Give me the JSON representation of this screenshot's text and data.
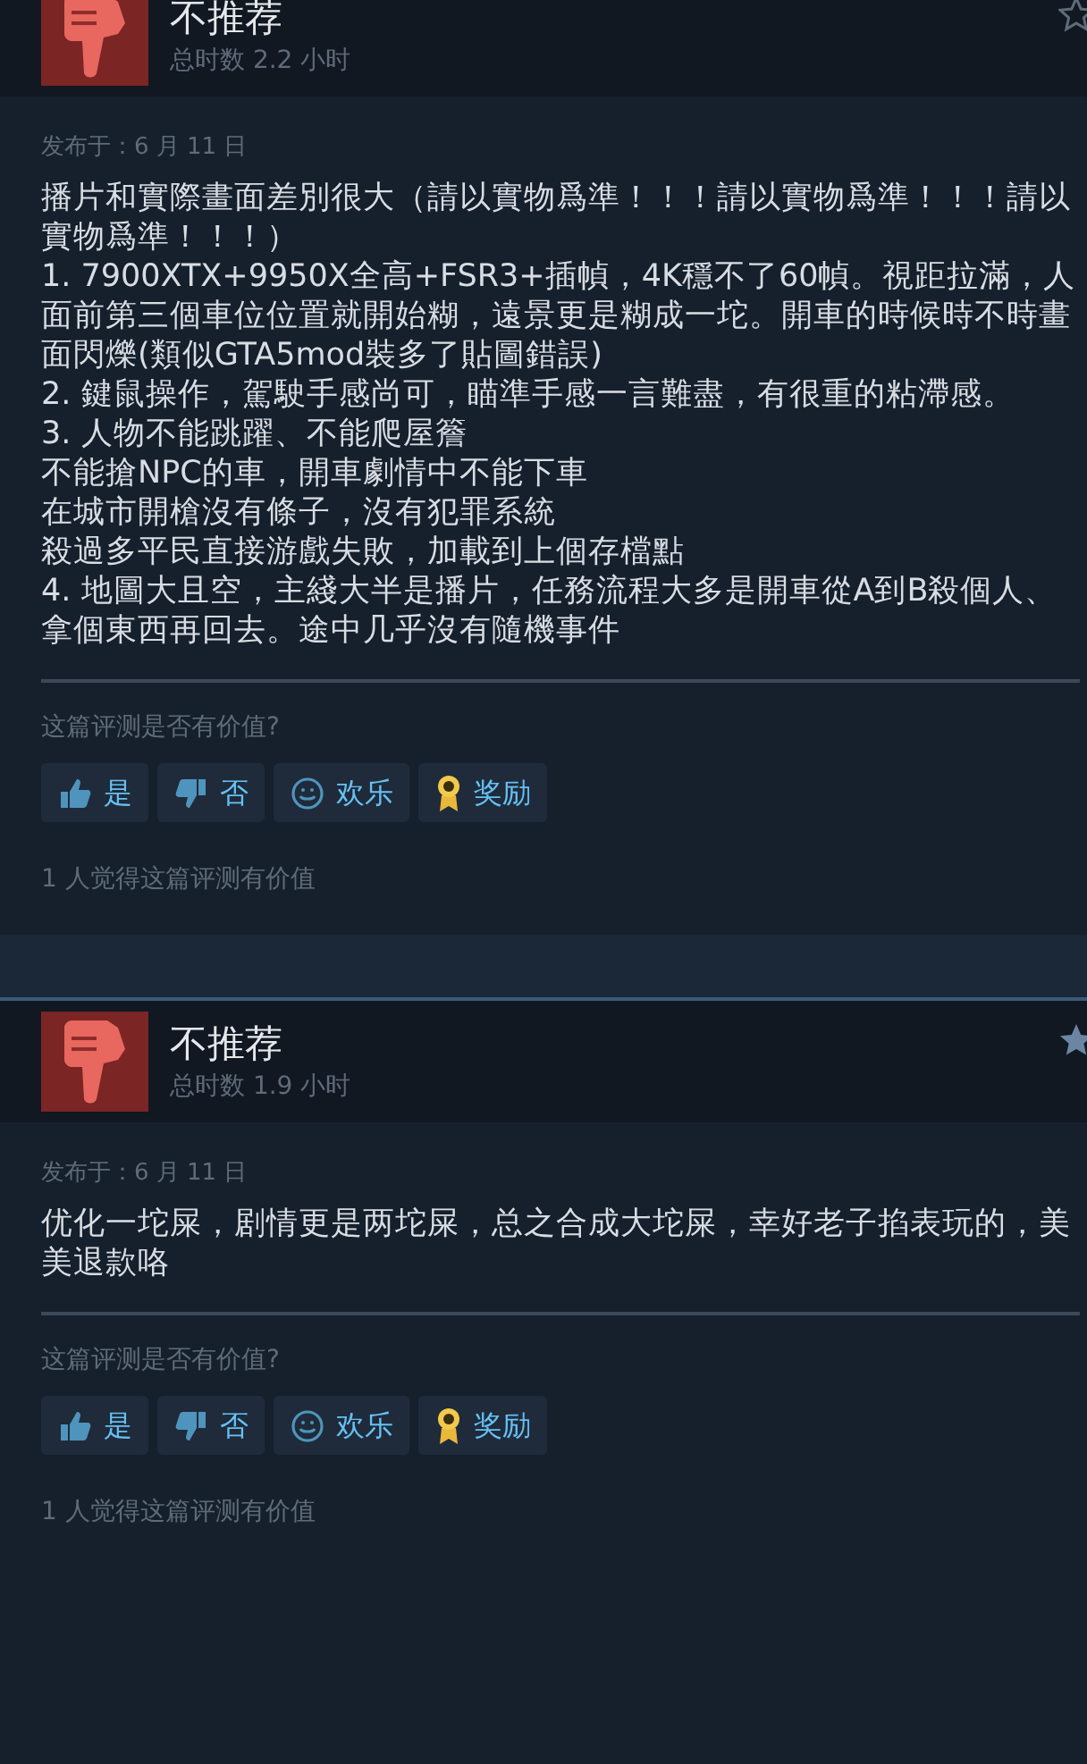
{
  "reviews": [
    {
      "verdict": "不推荐",
      "playtime": "总时数 2.2 小时",
      "starred": false,
      "posted": "发布于：6 月 11 日",
      "body": [
        "播片和實際畫面差別很大（請以實物爲準！！！請以實物爲準！！！請以實物爲準！！！）",
        "1. 7900XTX+9950X全高+FSR3+插幀，4K穩不了60幀。視距拉滿，人面前第三個車位位置就開始糊，遠景更是糊成一坨。開車的時候時不時畫面閃爍(類似GTA5mod裝多了貼圖錯誤)",
        "2. 鍵鼠操作，駕駛手感尚可，瞄準手感一言難盡，有很重的粘滯感。",
        "3. 人物不能跳躍、不能爬屋簷",
        "不能搶NPC的車，開車劇情中不能下車",
        "在城市開槍沒有條子，沒有犯罪系統",
        "殺過多平民直接游戲失敗，加載到上個存檔點",
        "4. 地圖大且空，主綫大半是播片，任務流程大多是開車從A到B殺個人、拿個東西再回去。途中几乎沒有隨機事件"
      ],
      "question": "这篇评测是否有价值?",
      "buttons": [
        {
          "kind": "yes",
          "label": "是"
        },
        {
          "kind": "no",
          "label": "否"
        },
        {
          "kind": "funny",
          "label": "欢乐"
        },
        {
          "kind": "award",
          "label": "奖励"
        }
      ],
      "helpful": "1 人觉得这篇评测有价值"
    },
    {
      "verdict": "不推荐",
      "playtime": "总时数 1.9 小时",
      "starred": true,
      "posted": "发布于：6 月 11 日",
      "body": [
        "优化一坨屎，剧情更是两坨屎，总之合成大坨屎，幸好老子掐表玩的，美美退款咯"
      ],
      "question": "这篇评测是否有价值?",
      "buttons": [
        {
          "kind": "yes",
          "label": "是"
        },
        {
          "kind": "no",
          "label": "否"
        },
        {
          "kind": "funny",
          "label": "欢乐"
        },
        {
          "kind": "award",
          "label": "奖励"
        }
      ],
      "helpful": "1 人觉得这篇评测有价值"
    }
  ]
}
